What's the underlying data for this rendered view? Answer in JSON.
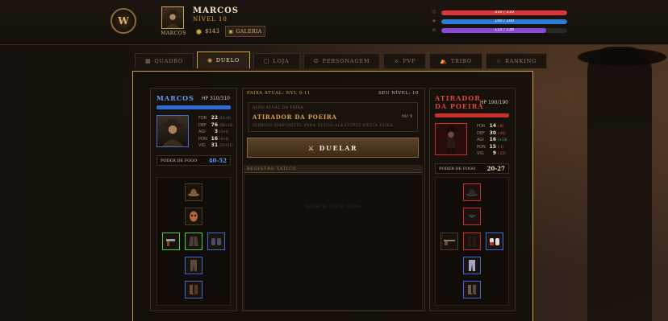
{
  "header": {
    "logo_text": "W",
    "avatar_label": "MARCOS",
    "player_name": "MARCOS",
    "player_level": "NÍVEL 10",
    "gold": "$143",
    "gallery_label": "GALERIA",
    "bars": [
      {
        "icon": "heart-icon",
        "glyph": "♡",
        "text": "310 / 310",
        "fraction": 1.0,
        "color": "#d9363a"
      },
      {
        "icon": "energy-icon",
        "glyph": "✧",
        "text": "100 / 100",
        "fraction": 1.0,
        "color": "#2f7ad9"
      },
      {
        "icon": "star-icon",
        "glyph": "☆",
        "text": "115 / 138",
        "fraction": 0.833,
        "color": "#8a4ad9"
      }
    ]
  },
  "tabs": [
    {
      "label": "QUADRO",
      "icon": "board-icon",
      "glyph": "▦",
      "active": false
    },
    {
      "label": "DUELO",
      "icon": "duel-icon",
      "glyph": "◉",
      "active": true
    },
    {
      "label": "LOJA",
      "icon": "shop-icon",
      "glyph": "▢",
      "active": false
    },
    {
      "label": "PERSONAGEM",
      "icon": "character-icon",
      "glyph": "☺",
      "active": false
    },
    {
      "label": "PVP",
      "icon": "pvp-icon",
      "glyph": "⚔",
      "active": false
    },
    {
      "label": "TRIBO",
      "icon": "tribe-icon",
      "glyph": "⛺",
      "active": false
    },
    {
      "label": "RANKING",
      "icon": "ranking-icon",
      "glyph": "☆",
      "active": false
    }
  ],
  "player": {
    "name": "MARCOS",
    "hp": "HP 310/310",
    "stats": [
      {
        "k": "FOR",
        "v": "22",
        "b": "(14+8)",
        "tone": ""
      },
      {
        "k": "DEF",
        "v": "76",
        "b": "(58+18)",
        "tone": ""
      },
      {
        "k": "AGI",
        "v": "3",
        "b": "(3+0)",
        "tone": ""
      },
      {
        "k": "PON",
        "v": "16",
        "b": "(8+8)",
        "tone": ""
      },
      {
        "k": "VIG",
        "v": "31",
        "b": "(20+11)",
        "tone": ""
      }
    ],
    "power_label": "PODER DE FOGO",
    "power_value": "40-52",
    "power_color": "#5b9bf0"
  },
  "center": {
    "range": "FAIXA ATUAL: NVL 9-11",
    "your_level": "SEU NÍVEL: 10",
    "target_caption": "ALVO ATUAL DA FAIXA",
    "target_name": "ATIRADOR DA POEIRA",
    "target_level": "Nvl 9",
    "target_desc": "INIMIGO DISPONÍVEL PARA DUELO ALEATÓRIO NESTA FAIXA.",
    "duel_label": "DUELAR",
    "log_title": "REGISTRO TÁTICO",
    "log_more": "...",
    "log_empty": "NENHUM DUELO AINDA"
  },
  "enemy": {
    "name_line1": "ATIRADOR",
    "name_line2": "DA POEIRA",
    "hp": "HP 190/190",
    "stats": [
      {
        "k": "FOR",
        "v": "14",
        "b": "(-8)",
        "tone": "r"
      },
      {
        "k": "DEF",
        "v": "30",
        "b": "(-46)",
        "tone": "r"
      },
      {
        "k": "AGI",
        "v": "16",
        "b": "(+13)",
        "tone": "g"
      },
      {
        "k": "PON",
        "v": "15",
        "b": "(-1)",
        "tone": "r"
      },
      {
        "k": "VIG",
        "v": "9",
        "b": "(-22)",
        "tone": "r"
      }
    ],
    "power_label": "PODER DE FOGO",
    "power_value": "20-27",
    "power_color": "#f0e2c2"
  }
}
